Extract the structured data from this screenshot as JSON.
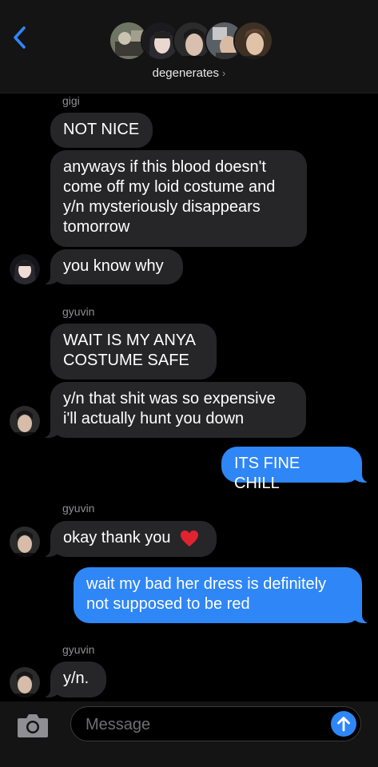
{
  "header": {
    "group_name": "degenerates",
    "chevron": "›",
    "back_icon": "chevron-left-icon",
    "avatar_count": 5
  },
  "messages": [
    {
      "type": "incoming",
      "sender": "gigi",
      "bubbles": [
        "NOT NICE",
        "anyways if this blood doesn't come off my loid costume and y/n mysteriously disappears tomorrow",
        "you know why"
      ]
    },
    {
      "type": "incoming",
      "sender": "gyuvin",
      "bubbles": [
        "WAIT IS MY ANYA COSTUME SAFE",
        "y/n that shit was so expensive i'll actually hunt you down"
      ]
    },
    {
      "type": "outgoing",
      "bubbles": [
        "ITS FINE CHILL"
      ]
    },
    {
      "type": "incoming",
      "sender": "gyuvin",
      "bubbles": [
        "okay thank you"
      ]
    },
    {
      "type": "outgoing",
      "bubbles": [
        "wait my bad her dress is definitely not supposed to be red"
      ]
    },
    {
      "type": "incoming",
      "sender": "gyuvin",
      "bubbles": [
        "y/n."
      ]
    }
  ],
  "composer": {
    "placeholder": "Message",
    "camera_icon": "camera-icon",
    "send_icon": "arrow-up-icon"
  },
  "colors": {
    "outgoing_bubble": "#2f86f6",
    "incoming_bubble": "#262629",
    "background": "#000000",
    "header": "#141414",
    "heart": "#e0242f"
  }
}
